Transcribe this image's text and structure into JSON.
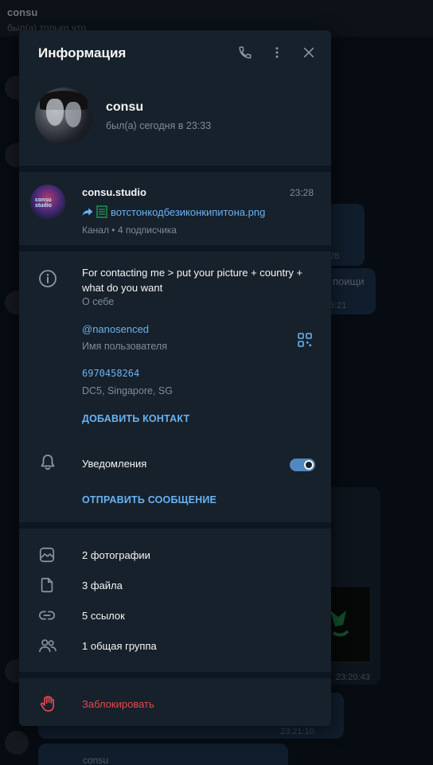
{
  "background": {
    "chat_title": "consu",
    "chat_status": "был(а) только что",
    "msg_snippet": "поищи",
    "times": [
      "23:20:43",
      "23:21:10"
    ],
    "bottom_preview": "consu",
    "partial_times": [
      "28",
      "5:21"
    ]
  },
  "panel": {
    "title": "Информация",
    "header_icons": [
      "phone-icon",
      "more-vertical-icon",
      "close-icon"
    ]
  },
  "profile": {
    "name": "consu",
    "status": "был(а) сегодня в 23:33"
  },
  "channel": {
    "name": "consu.studio",
    "time": "23:28",
    "last_message": "вотстонкодбезиконкипитона.png",
    "meta": "Канал • 4 подписчика",
    "avatar_text": "consu studio"
  },
  "info": {
    "about": "For contacting me > put your picture + country + what do you want",
    "about_label": "О себе",
    "username": "@nanosenced",
    "username_label": "Имя пользователя",
    "phone": "6970458264",
    "phone_label": "DC5, Singapore, SG",
    "add_contact": "ДОБАВИТЬ КОНТАКТ",
    "notifications_label": "Уведомления",
    "notifications_enabled": true,
    "send_message": "ОТПРАВИТЬ СООБЩЕНИЕ"
  },
  "media": {
    "photos": "2 фотографии",
    "files": "3 файла",
    "links": "5 ссылок",
    "groups": "1 общая группа"
  },
  "block": {
    "label": "Заблокировать"
  },
  "colors": {
    "accent": "#6ab2f2",
    "panel_bg": "#17212b",
    "danger": "#e5484d",
    "toggle": "#5288c1"
  }
}
